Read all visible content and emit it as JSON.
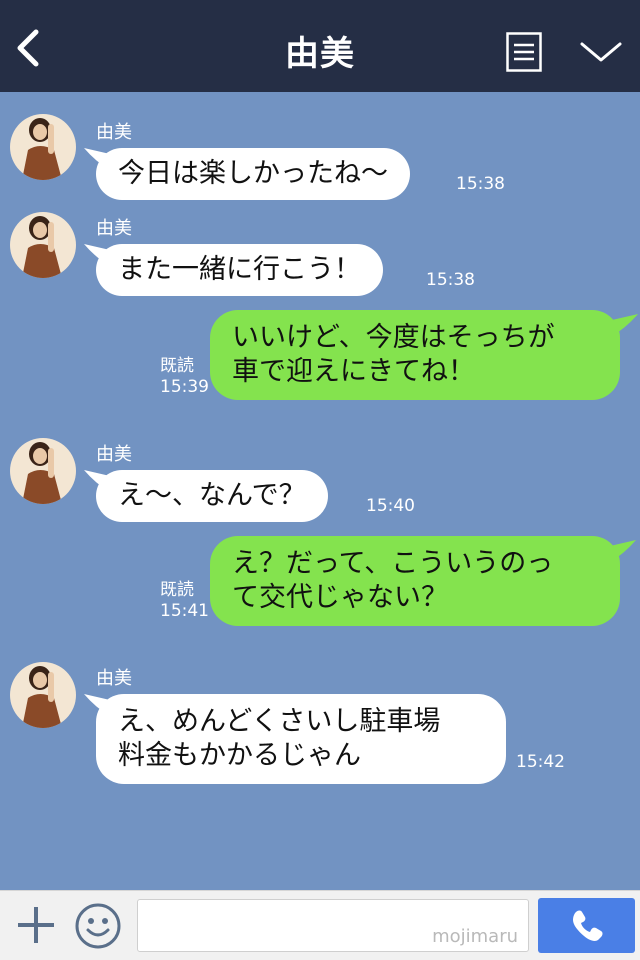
{
  "header": {
    "title": "由美"
  },
  "messages": [
    {
      "direction": "in",
      "sender": "由美",
      "lines": [
        "今日は楽しかったね〜"
      ],
      "time": "15:38"
    },
    {
      "direction": "in",
      "sender": "由美",
      "lines": [
        "また一緒に行こう！"
      ],
      "time": "15:38"
    },
    {
      "direction": "out",
      "lines": [
        "いいけど、今度はそっちが",
        "車で迎えにきてね！"
      ],
      "read": "既読",
      "time": "15:39"
    },
    {
      "direction": "in",
      "sender": "由美",
      "lines": [
        "え〜、なんで？"
      ],
      "time": "15:40"
    },
    {
      "direction": "out",
      "lines": [
        "え？だって、こういうのっ",
        "て交代じゃない？"
      ],
      "read": "既読",
      "time": "15:41"
    },
    {
      "direction": "in",
      "sender": "由美",
      "lines": [
        "え、めんどくさいし駐車場",
        "料金もかかるじゃん"
      ],
      "time": "15:42"
    }
  ],
  "footer": {
    "input_value": "",
    "watermark": "mojimaru"
  },
  "colors": {
    "header_bg": "#252e45",
    "chat_bg": "#7293c2",
    "incoming_bubble": "#ffffff",
    "outgoing_bubble": "#84e34e",
    "call_button": "#4a7fe6"
  },
  "icons": {
    "back": "chevron-left-icon",
    "menu": "menu-icon",
    "collapse": "chevron-down-icon",
    "plus": "plus-icon",
    "emoji": "smiley-icon",
    "call": "phone-icon"
  }
}
